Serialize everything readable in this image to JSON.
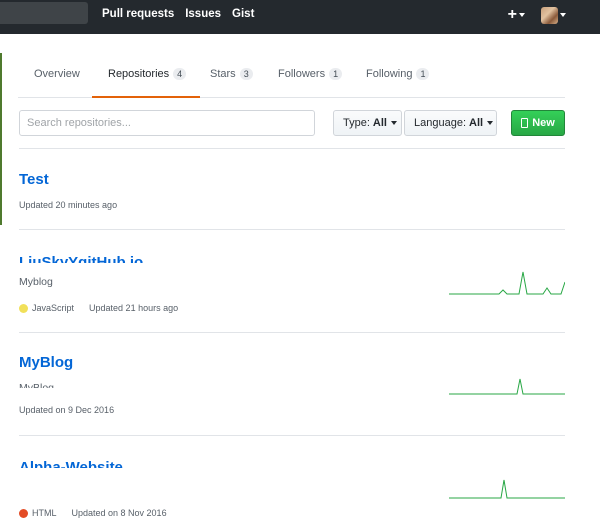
{
  "header": {
    "nav": [
      "Pull requests",
      "Issues",
      "Gist"
    ],
    "plus_label": "+"
  },
  "tabs": [
    {
      "label": "Overview",
      "count": ""
    },
    {
      "label": "Repositories",
      "count": "4",
      "selected": true
    },
    {
      "label": "Stars",
      "count": "3"
    },
    {
      "label": "Followers",
      "count": "1"
    },
    {
      "label": "Following",
      "count": "1"
    }
  ],
  "filters": {
    "search_placeholder": "Search repositories...",
    "type_label": "Type:",
    "type_value": "All",
    "language_label": "Language:",
    "language_value": "All",
    "new_label": "New"
  },
  "repos": [
    {
      "name": "Test",
      "description": "",
      "language": "",
      "updated": "Updated 20 minutes ago"
    },
    {
      "name": "LiuSkyYgitHub.io",
      "description": "Myblog",
      "language": "JavaScript",
      "language_color": "#f1e05a",
      "updated": "Updated 21 hours ago"
    },
    {
      "name": "MyBlog",
      "description": "MyBlog",
      "language": "",
      "updated": "Updated on 9 Dec 2016"
    },
    {
      "name": "Alpha-Website",
      "description": "",
      "language": "HTML",
      "language_color": "#e34c26",
      "updated": "Updated on 8 Nov 2016"
    }
  ],
  "colors": {
    "header_bg": "#24292e",
    "link": "#0366d6",
    "new_button": "#28a745",
    "tab_underline": "#e36209",
    "sparkline": "#28a745"
  }
}
